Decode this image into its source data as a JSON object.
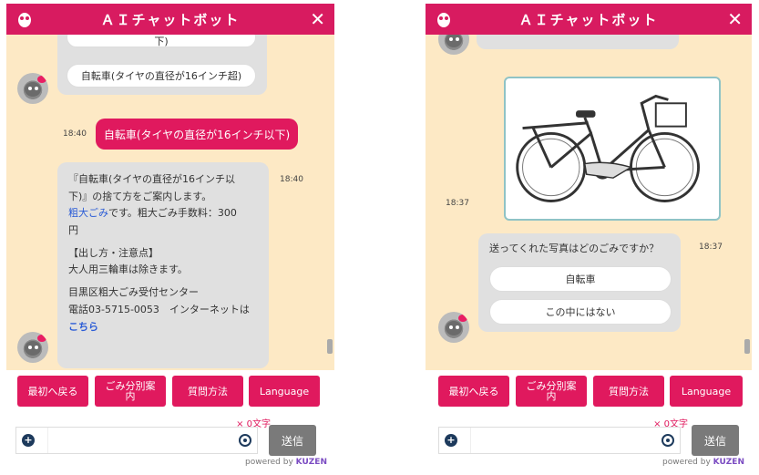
{
  "left": {
    "title": "ＡＩチャットボット",
    "close": "✕",
    "top_option_partial": "下)",
    "option_bike_over16": "自転車(タイヤの直径が16インチ超)",
    "user_time": "18:40",
    "user_msg": "自転車(タイヤの直径が16インチ以下)",
    "bot_time": "18:40",
    "bot_line1": "『自転車(タイヤの直径が16インチ以",
    "bot_line2": "下)』の捨て方をご案内します。",
    "bot_link1": "粗大ごみ",
    "bot_line3_rest": "です。粗大ごみ手数料：300",
    "bot_line4": "円",
    "bot_line5": "【出し方・注意点】",
    "bot_line6": "大人用三輪車は除きます。",
    "bot_line7": "目黒区粗大ごみ受付センター",
    "bot_line8": "電話03-5715-0053　インターネットは",
    "bot_link2": "こちら"
  },
  "right": {
    "title": "ＡＩチャットボット",
    "close": "✕",
    "photo_time": "18:37",
    "question_time": "18:37",
    "question": "送ってくれた写真はどのごみですか？",
    "option1": "自転車",
    "option2": "この中にはない"
  },
  "buttons": {
    "back": "最初へ戻る",
    "guide_line1": "ごみ分別案",
    "guide_line2": "内",
    "question": "質問方法",
    "language": "Language"
  },
  "input": {
    "counter": "× 0文字",
    "send": "送信",
    "powered_prefix": "powered by ",
    "powered_brand": "KUZEN"
  },
  "colors": {
    "brand": "#d81b60",
    "chat_bg": "#fde9c5",
    "bubble": "#e0e0e0"
  }
}
